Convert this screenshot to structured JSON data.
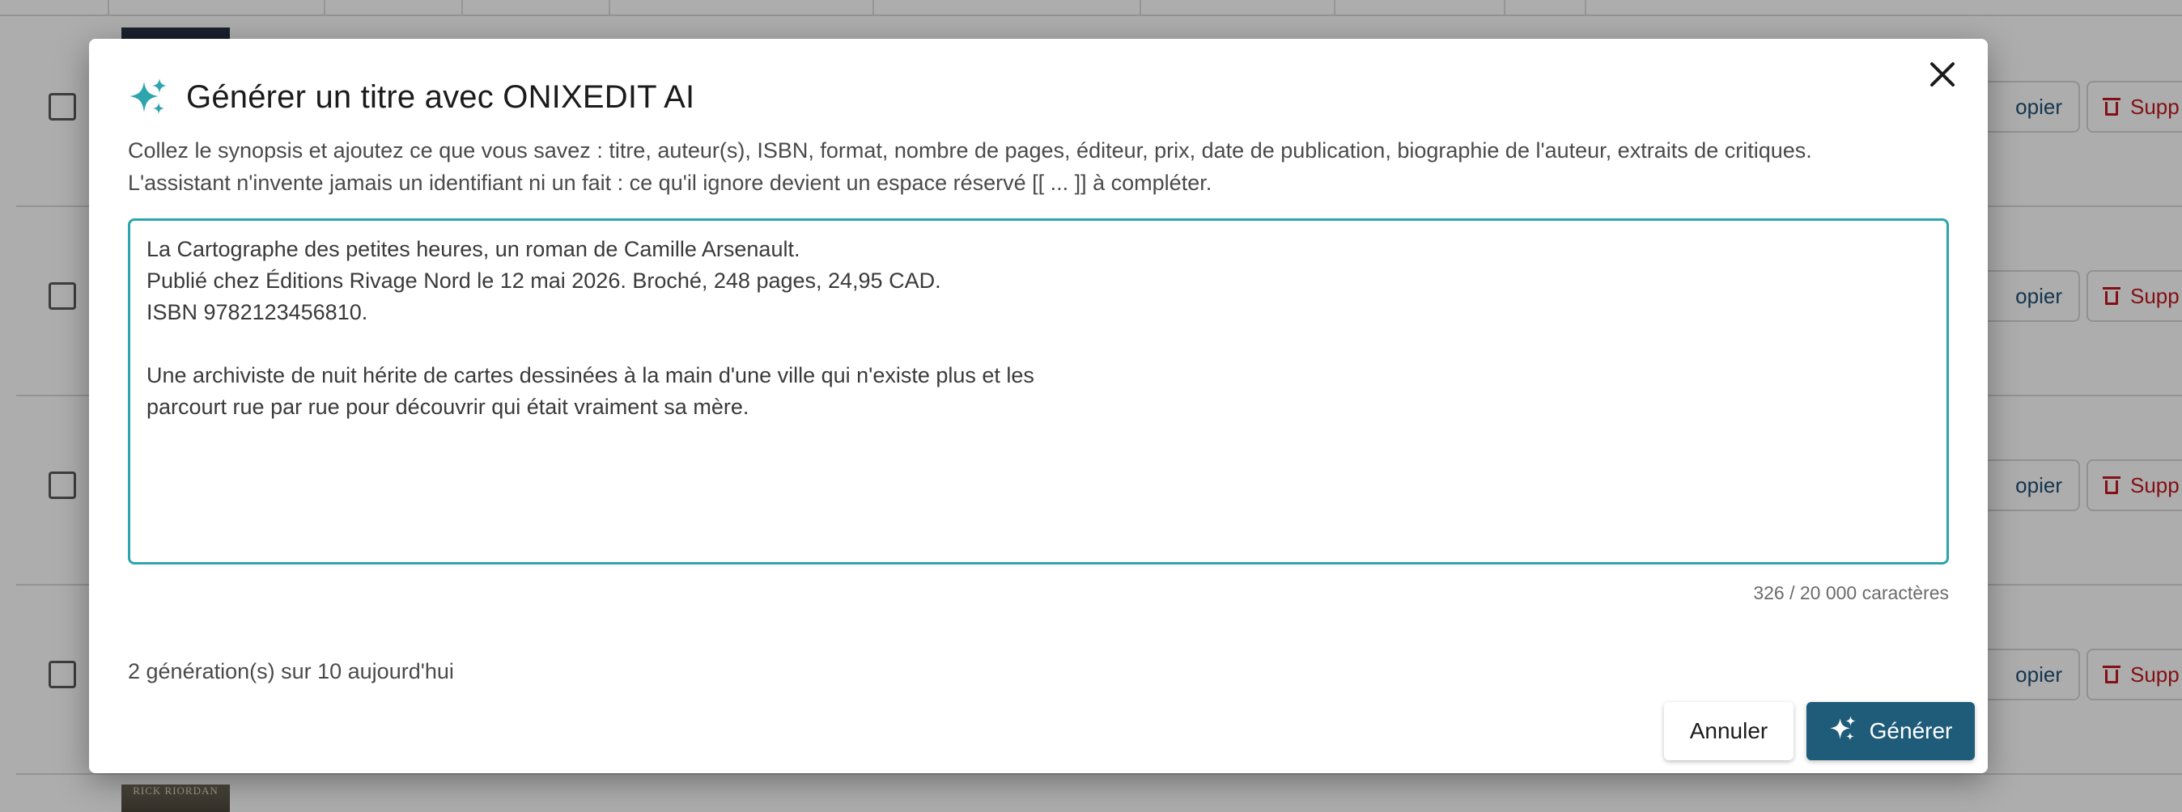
{
  "background_table": {
    "row_actions": {
      "copy_label": "opier",
      "delete_label": "Supp"
    },
    "covers": {
      "bottom_cover_text": "RICK RIORDAN"
    }
  },
  "modal": {
    "title": "Générer un titre avec ONIXEDIT AI",
    "intro_line1": "Collez le synopsis et ajoutez ce que vous savez : titre, auteur(s), ISBN, format, nombre de pages, éditeur, prix, date de publication, biographie de l'auteur, extraits de critiques.",
    "intro_line2": "L'assistant n'invente jamais un identifiant ni un fait : ce qu'il ignore devient un espace réservé [[ ... ]] à compléter.",
    "synopsis_value": "La Cartographe des petites heures, un roman de Camille Arsenault.\nPublié chez Éditions Rivage Nord le 12 mai 2026. Broché, 248 pages, 24,95 CAD.\nISBN 9782123456810.\n\nUne archiviste de nuit hérite de cartes dessinées à la main d'une ville qui n'existe plus et les\nparcourt rue par rue pour découvrir qui était vraiment sa mère.",
    "char_counter": "326 / 20 000 caractères",
    "usage_text": "2 génération(s) sur 10 aujourd'hui",
    "cancel_label": "Annuler",
    "generate_label": "Générer"
  },
  "colors": {
    "accent_teal": "#2ea5ad",
    "primary_button": "#1f5c7a",
    "danger": "#c2191f"
  }
}
